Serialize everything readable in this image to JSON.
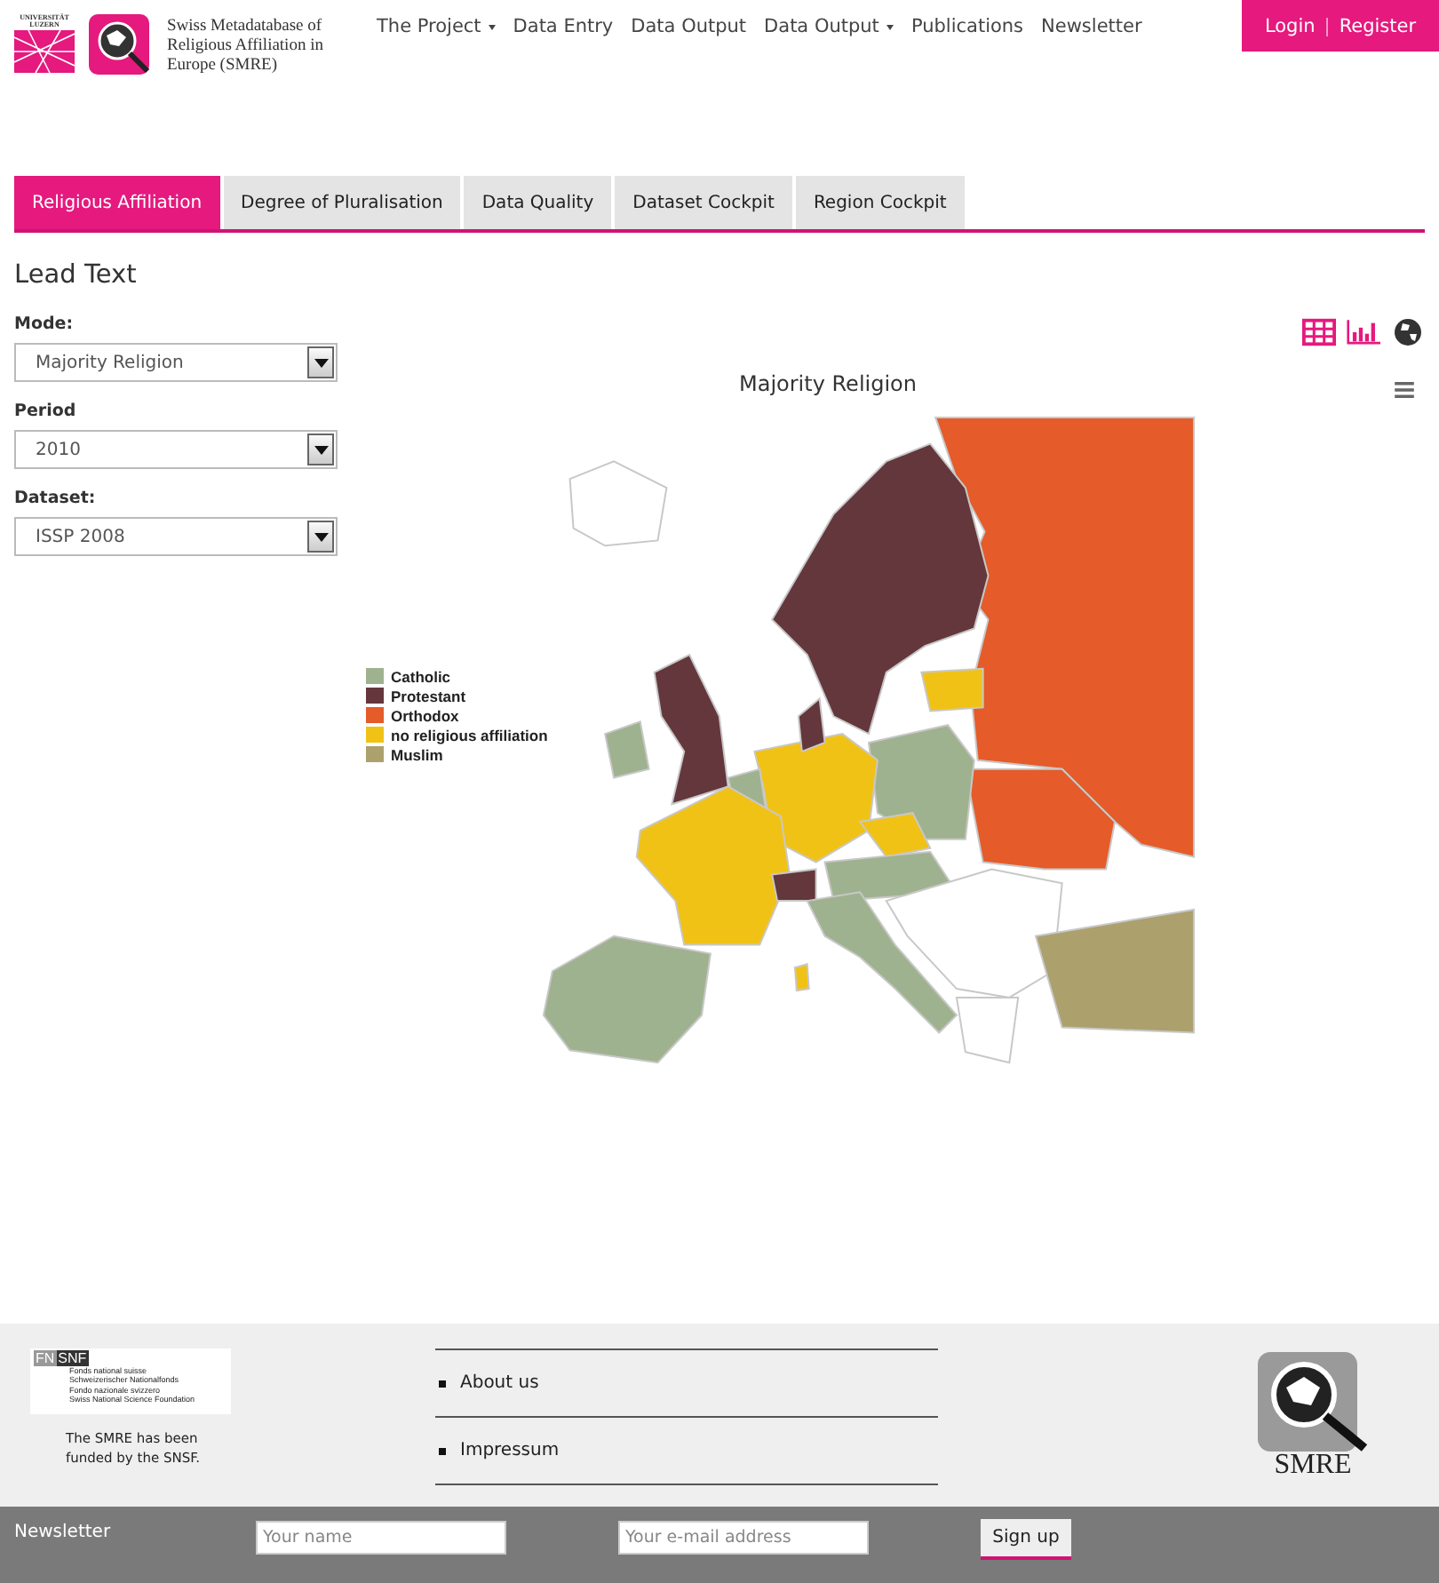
{
  "header": {
    "university_logo": [
      "UNIVERSITÄT",
      "LUZERN"
    ],
    "site_title": "Swiss Metadatabase of Religious Affiliation in Europe (SMRE)",
    "nav": [
      {
        "label": "The Project",
        "dropdown": true
      },
      {
        "label": "Data Entry",
        "dropdown": false
      },
      {
        "label": "Data Output",
        "dropdown": false
      },
      {
        "label": "Data Output",
        "dropdown": true
      },
      {
        "label": "Publications",
        "dropdown": false
      },
      {
        "label": "Newsletter",
        "dropdown": false
      }
    ],
    "login": "Login",
    "separator": "|",
    "register": "Register"
  },
  "tabs": [
    {
      "label": "Religious Affiliation",
      "selected": true
    },
    {
      "label": "Degree of Pluralisation",
      "selected": false
    },
    {
      "label": "Data Quality",
      "selected": false
    },
    {
      "label": "Dataset Cockpit",
      "selected": false
    },
    {
      "label": "Region Cockpit",
      "selected": false
    }
  ],
  "lead_text": "Lead Text",
  "filters": [
    {
      "label": "Mode:",
      "value": "Majority Religion"
    },
    {
      "label": "Period",
      "value": "2010"
    },
    {
      "label": "Dataset:",
      "value": "ISSP 2008"
    }
  ],
  "views": [
    {
      "kind": "table",
      "selected": false
    },
    {
      "kind": "chart",
      "selected": false
    },
    {
      "kind": "map",
      "selected": true
    }
  ],
  "map": {
    "title": "Majority Religion",
    "legend": [
      {
        "label": "Catholic",
        "color": "#9fb28f"
      },
      {
        "label": "Protestant",
        "color": "#63373b"
      },
      {
        "label": "Orthodox",
        "color": "#e55b29"
      },
      {
        "label": "no religious affiliation",
        "color": "#f1c216"
      },
      {
        "label": "Muslim",
        "color": "#aca06d"
      }
    ]
  },
  "footer": {
    "funder_logo": {
      "mark_left": "FN",
      "mark_right": "SNF",
      "lines": [
        "Fonds national suisse",
        "Schweizerischer Nationalfonds",
        "Fondo nazionale svizzero",
        "Swiss National Science Foundation"
      ]
    },
    "funded_note": "The SMRE has been funded by the SNSF.",
    "links": [
      "About us",
      "Impressum"
    ],
    "logo_text": "SMRE"
  },
  "newsletter": {
    "label": "Newsletter",
    "name_placeholder": "Your name",
    "email_placeholder": "Your e-mail address",
    "button": "Sign up"
  }
}
